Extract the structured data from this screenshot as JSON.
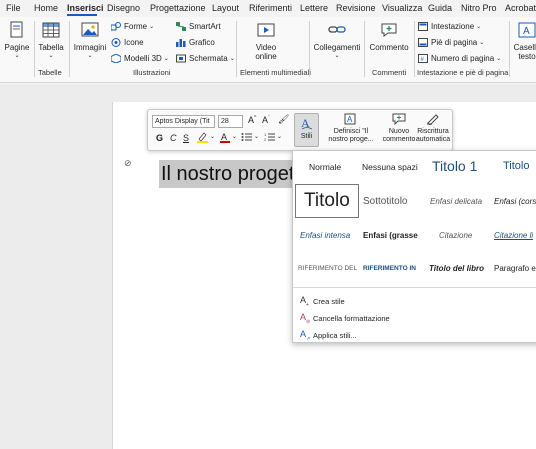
{
  "menu": {
    "tabs": [
      "File",
      "Home",
      "Inserisci",
      "Disegno",
      "Progettazione",
      "Layout",
      "Riferimenti",
      "Lettere",
      "Revisione",
      "Visualizza",
      "Guida",
      "Nitro Pro",
      "Acrobat"
    ],
    "active": "Inserisci"
  },
  "ribbon": {
    "pagine": "Pagine",
    "tabella": "Tabella",
    "immagini": "Immagini",
    "forme": "Forme",
    "icone": "Icone",
    "modelli3d": "Modelli 3D",
    "smartart": "SmartArt",
    "grafico": "Grafico",
    "schermata": "Schermata",
    "video_online_1": "Video",
    "video_online_2": "online",
    "collegamenti": "Collegamenti",
    "commento": "Commento",
    "intestazione": "Intestazione",
    "pie_di_pagina": "Piè di pagina",
    "numero_di_pagina": "Numero di pagina",
    "casella_1": "Casella",
    "casella_2": "testo",
    "groups": {
      "tabelle": "Tabelle",
      "illustrazioni": "Illustrazioni",
      "multimediali": "Elementi multimediali",
      "commenti": "Commenti",
      "intestazione_pie": "Intestazione e piè di pagina"
    }
  },
  "document": {
    "heading_text": "Il nostro progetto"
  },
  "mini_toolbar": {
    "font": "Aptos Display (Tit",
    "size": "28",
    "grow": "A^",
    "shrink": "A˅",
    "bold": "G",
    "italic": "C",
    "underline": "S",
    "stili": "Stili",
    "definisci_1": "Definisci \"Il",
    "definisci_2": "nostro proge...",
    "nuovo_1": "Nuovo",
    "nuovo_2": "commento",
    "riscrittura_1": "Riscrittura",
    "riscrittura_2": "automatica"
  },
  "styles_gallery": {
    "row1": [
      "Normale",
      "Nessuna spazi",
      "Titolo 1",
      "Titolo"
    ],
    "row2": [
      "Titolo",
      "Sottotitolo",
      "Enfasi delicata",
      "Enfasi (cors"
    ],
    "row3": [
      "Enfasi intensa",
      "Enfasi (grasse",
      "Citazione",
      "Citazione li"
    ],
    "row4": [
      "RIFERIMENTO DEL",
      "RIFERIMENTO IN",
      "Titolo del libro",
      "Paragrafo e"
    ],
    "commands": [
      "Crea stile",
      "Cancella formattazione",
      "Applica stili..."
    ]
  },
  "colors": {
    "accent": "#185abd",
    "title_blue": "#1f4e79"
  }
}
